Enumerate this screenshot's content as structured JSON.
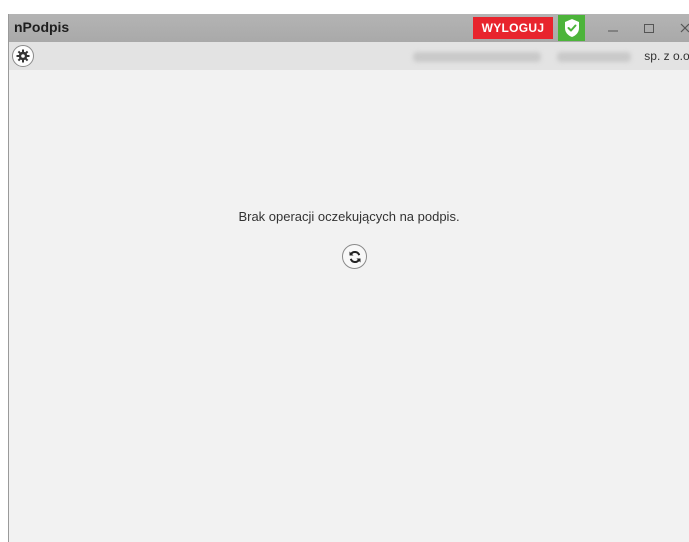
{
  "window": {
    "title": "nPodpis"
  },
  "titlebar": {
    "logout_label": "WYLOGUJ",
    "shield_icon": "shield-check-icon",
    "controls": [
      "minimize-icon",
      "maximize-icon",
      "close-icon"
    ],
    "colors": {
      "logout_bg": "#e8242d",
      "shield_bg": "#4cb43a"
    }
  },
  "subbar": {
    "settings_icon": "gear-icon",
    "company_suffix": "sp. z o.o."
  },
  "main": {
    "empty_message": "Brak operacji oczekujących na podpis.",
    "refresh_icon": "refresh-icon"
  }
}
